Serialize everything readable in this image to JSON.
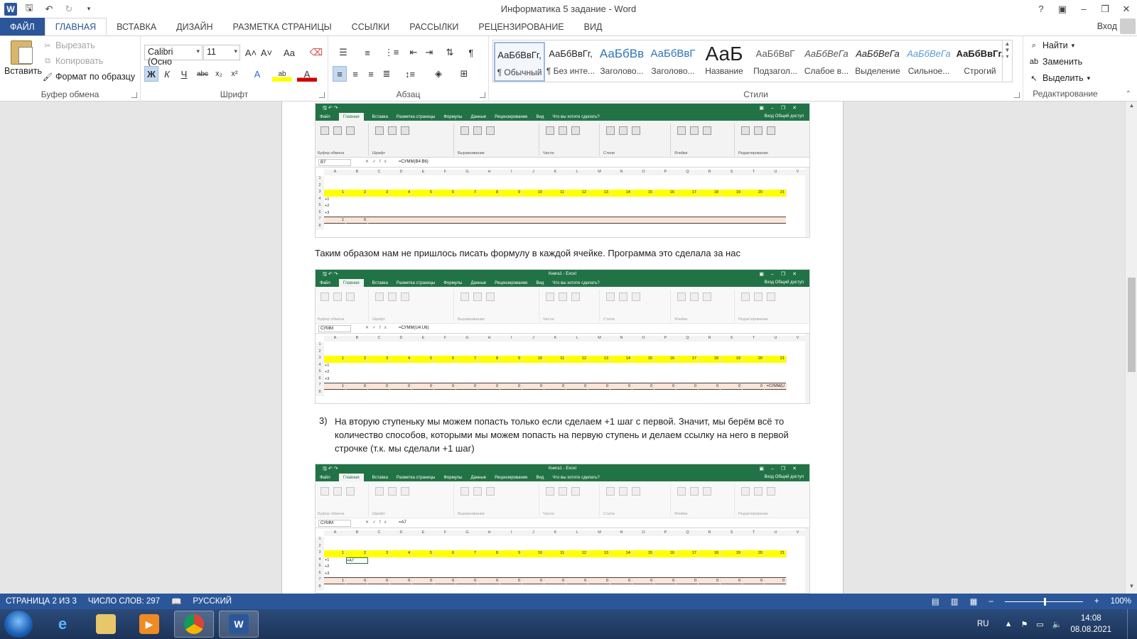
{
  "titlebar": {
    "title": "Информатика 5 задание - Word",
    "logo": "W",
    "controls": [
      "?",
      "▣",
      "–",
      "❐",
      "✕"
    ]
  },
  "tabs": {
    "items": [
      "ФАЙЛ",
      "ГЛАВНАЯ",
      "ВСТАВКА",
      "ДИЗАЙН",
      "РАЗМЕТКА СТРАНИЦЫ",
      "ССЫЛКИ",
      "РАССЫЛКИ",
      "РЕЦЕНЗИРОВАНИЕ",
      "ВИД"
    ],
    "active": "ГЛАВНАЯ",
    "signin": "Вход"
  },
  "ribbon": {
    "clipboard": {
      "paste": "Вставить",
      "cut": "Вырезать",
      "copy": "Копировать",
      "format_painter": "Формат по образцу",
      "label": "Буфер обмена"
    },
    "font": {
      "name": "Calibri (Осно",
      "size": "11",
      "label": "Шрифт",
      "tools": [
        "A˄",
        "A˅",
        "Aa",
        "Ж",
        "К",
        "Ч",
        "abc",
        "x₂",
        "x²",
        "A",
        "ab",
        "A"
      ]
    },
    "paragraph": {
      "label": "Абзац"
    },
    "styles": {
      "label": "Стили",
      "items": [
        {
          "sample": "АаБбВвГг,",
          "name": "¶ Обычный"
        },
        {
          "sample": "АаБбВвГг,",
          "name": "¶ Без инте..."
        },
        {
          "sample": "АаБбВв",
          "name": "Заголово..."
        },
        {
          "sample": "АаБбВвГ",
          "name": "Заголово..."
        },
        {
          "sample": "АаБ",
          "name": "Название"
        },
        {
          "sample": "АаБбВвГ",
          "name": "Подзагол..."
        },
        {
          "sample": "АаБбВеГа",
          "name": "Слабое в..."
        },
        {
          "sample": "АаБбВеГа",
          "name": "Выделение"
        },
        {
          "sample": "АаБбВеГа",
          "name": "Сильное..."
        },
        {
          "sample": "АаБбВвГг,",
          "name": "Строгий"
        }
      ]
    },
    "editing": {
      "label": "Редактирование",
      "find": "Найти",
      "replace": "Заменить",
      "select": "Выделить"
    }
  },
  "document": {
    "para1": "Таким образом нам не пришлось писать формулу в каждой ячейке. Программа это сделала за нас",
    "list3_num": "3)",
    "list3_line1": "На вторую ступеньку мы можем попасть только если сделаем +1 шаг с первой. Значит, мы берём всё то",
    "list3_line2": "количество способов, которыми мы можем попасть на первую ступень и делаем ссылку на него в первой",
    "list3_line3": "строчке (т.к. мы сделали +1 шаг)"
  },
  "excel": {
    "title": "Книга1 - Excel",
    "tabs": [
      "Файл",
      "Главная",
      "Вставка",
      "Разметка страницы",
      "Формулы",
      "Данные",
      "Рецензирование",
      "Вид",
      "Что вы хотите сделать?"
    ],
    "share": "Вход  Общий доступ",
    "groups": [
      "Буфер обмена",
      "Шрифт",
      "Выравнивание",
      "Число",
      "Стили",
      "Ячейки",
      "Редактирование"
    ],
    "columns": [
      "A",
      "B",
      "C",
      "D",
      "E",
      "F",
      "G",
      "H",
      "I",
      "J",
      "K",
      "L",
      "M",
      "N",
      "O",
      "P",
      "Q",
      "R",
      "S",
      "T",
      "U",
      "V"
    ],
    "row3": [
      "1",
      "2",
      "3",
      "4",
      "5",
      "6",
      "7",
      "8",
      "9",
      "10",
      "11",
      "12",
      "13",
      "14",
      "15",
      "16",
      "17",
      "18",
      "19",
      "20",
      "21"
    ],
    "row_labels": [
      "+1",
      "+2",
      "+3"
    ],
    "shots": [
      {
        "namebox": "B7",
        "formula": "=СУММ(B4:B6)",
        "row7": [
          "1",
          "0"
        ]
      },
      {
        "namebox": "СУММ",
        "formula": "=СУММ(U4:U6)",
        "row7": [
          "1",
          "0",
          "0",
          "0",
          "0",
          "0",
          "0",
          "0",
          "0",
          "0",
          "0",
          "0",
          "0",
          "0",
          "0",
          "0",
          "0",
          "0",
          "0",
          "0",
          "=СУММ(U"
        ]
      },
      {
        "namebox": "СУММ",
        "formula": "=A7",
        "b4": "=A7",
        "row7": [
          "1",
          "0",
          "0",
          "0",
          "0",
          "0",
          "0",
          "0",
          "0",
          "0",
          "0",
          "0",
          "0",
          "0",
          "0",
          "0",
          "0",
          "0",
          "0",
          "0",
          "0"
        ]
      }
    ]
  },
  "statusbar": {
    "page": "СТРАНИЦА 2 ИЗ 3",
    "words": "ЧИСЛО СЛОВ: 297",
    "lang": "РУССКИЙ",
    "zoom": "100%"
  },
  "taskbar": {
    "lang": "RU",
    "time": "14:08",
    "date": "08.08.2021"
  },
  "colors": {
    "word_blue": "#2b579a",
    "excel_green": "#217346",
    "yellow_row": "#ffff00",
    "peach_row": "#fce4d6"
  }
}
